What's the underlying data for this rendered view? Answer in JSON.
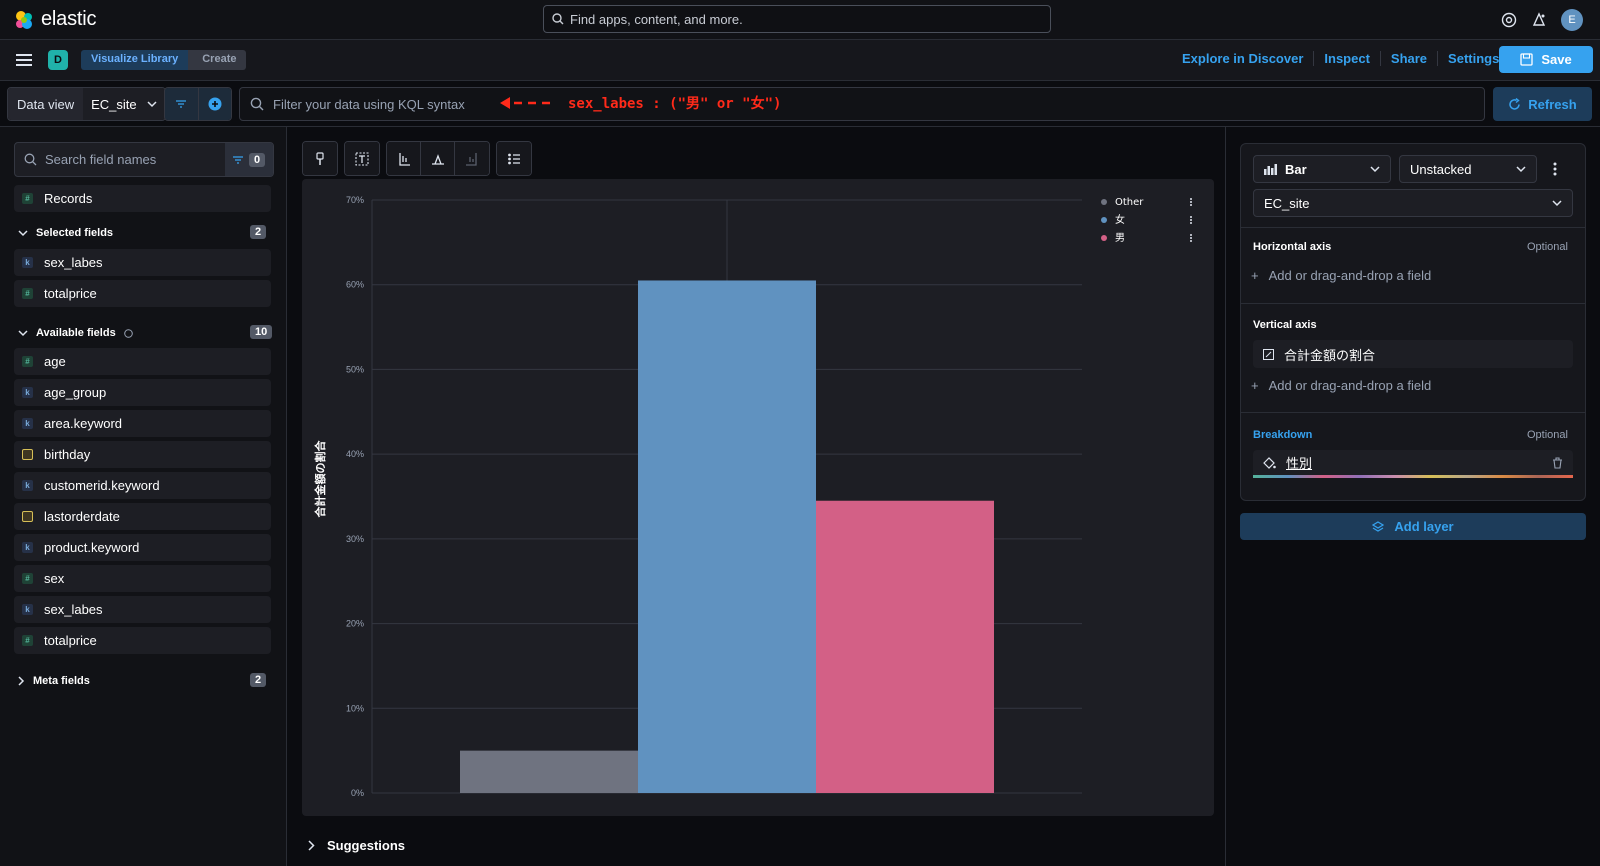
{
  "header": {
    "brand": "elastic",
    "search_placeholder": "Find apps, content, and more.",
    "avatar_initial": "E"
  },
  "appbar": {
    "space_initial": "D",
    "breadcrumbs": [
      "Visualize Library",
      "Create"
    ],
    "links": [
      "Explore in Discover",
      "Inspect",
      "Share",
      "Settings"
    ],
    "save_label": "Save"
  },
  "querybar": {
    "dataview_label": "Data view",
    "dataview_value": "EC_site",
    "kql_placeholder": "Filter your data using KQL syntax",
    "annotation": "sex_labes : (\"男\" or \"女\")",
    "refresh_label": "Refresh"
  },
  "sidebar": {
    "search_placeholder": "Search field names",
    "filter_count": "0",
    "records_label": "Records",
    "selected_title": "Selected fields",
    "selected_count": "2",
    "selected_fields": [
      {
        "name": "sex_labes",
        "type": "k"
      },
      {
        "name": "totalprice",
        "type": "#"
      }
    ],
    "available_title": "Available fields",
    "available_count": "10",
    "available_fields": [
      {
        "name": "age",
        "type": "#"
      },
      {
        "name": "age_group",
        "type": "k"
      },
      {
        "name": "area.keyword",
        "type": "k"
      },
      {
        "name": "birthday",
        "type": "date"
      },
      {
        "name": "customerid.keyword",
        "type": "k"
      },
      {
        "name": "lastorderdate",
        "type": "date"
      },
      {
        "name": "product.keyword",
        "type": "k"
      },
      {
        "name": "sex",
        "type": "#"
      },
      {
        "name": "sex_labes",
        "type": "k"
      },
      {
        "name": "totalprice",
        "type": "#"
      }
    ],
    "meta_title": "Meta fields",
    "meta_count": "2"
  },
  "suggestions_label": "Suggestions",
  "config": {
    "chart_type": "Bar",
    "stacking": "Unstacked",
    "dataview": "EC_site",
    "horizontal_axis_label": "Horizontal axis",
    "optional_label": "Optional",
    "add_field_label": "Add or drag-and-drop a field",
    "vertical_axis_label": "Vertical axis",
    "vertical_metric": "合計金額の割合",
    "breakdown_label": "Breakdown",
    "breakdown_field": "性別",
    "add_layer_label": "Add layer"
  },
  "chart_data": {
    "type": "bar",
    "ylabel": "合計金額の割合",
    "ylim": [
      0,
      70
    ],
    "yticks": [
      "0%",
      "10%",
      "20%",
      "30%",
      "40%",
      "50%",
      "60%",
      "70%"
    ],
    "legend_position": "top-right",
    "grid": true,
    "series": [
      {
        "name": "Other",
        "value": 5,
        "color": "#6f7380"
      },
      {
        "name": "女",
        "value": 60.5,
        "color": "#6092c0"
      },
      {
        "name": "男",
        "value": 34.5,
        "color": "#d36086"
      }
    ]
  }
}
